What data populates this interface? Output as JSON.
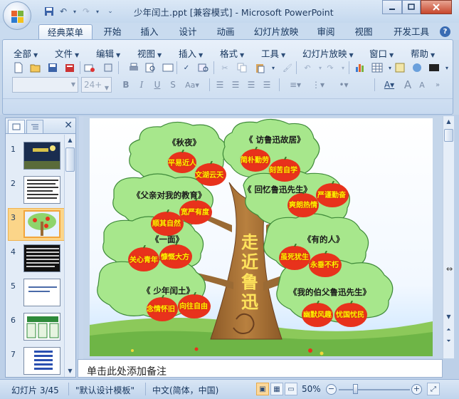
{
  "window": {
    "title": "少年闰土.ppt [兼容模式] - Microsoft PowerPoint",
    "qat": [
      "save-icon",
      "undo-icon",
      "redo-icon",
      "customize-icon"
    ]
  },
  "ribbon_tabs": [
    "经典菜单",
    "开始",
    "插入",
    "设计",
    "动画",
    "幻灯片放映",
    "审阅",
    "视图",
    "开发工具"
  ],
  "classic_menu": [
    "全部",
    "文件",
    "编辑",
    "视图",
    "插入",
    "格式",
    "工具",
    "幻灯片放映",
    "窗口",
    "帮助"
  ],
  "font": {
    "name": "",
    "size": "24+"
  },
  "slide_panel": {
    "thumbnail_numbers": [
      "1",
      "2",
      "3",
      "4",
      "5",
      "6",
      "7"
    ],
    "selected_index": 3
  },
  "slide": {
    "trunk_title": [
      "走",
      "近",
      "鲁",
      "迅"
    ],
    "branches": [
      {
        "title": "《秋夜》",
        "apples": [
          "平易近人",
          "文湖云天"
        ]
      },
      {
        "title": "《 访鲁迅故居》",
        "apples": [
          "简朴勤劳",
          "刻苦自学"
        ]
      },
      {
        "title": "《父亲对我的教育》",
        "apples": [
          "顺其自然",
          "宽严有度"
        ]
      },
      {
        "title": "《 回忆鲁迅先生》",
        "apples": [
          "爽朗热情",
          "严谨勤奋"
        ]
      },
      {
        "title": "《一面》",
        "apples": [
          "关心青年",
          "慷慨大方"
        ]
      },
      {
        "title": "《有的人》",
        "apples": [
          "虽死犹生",
          "永垂不朽"
        ]
      },
      {
        "title": "《 少年闰土》",
        "apples": [
          "念情怀旧",
          "向往自由"
        ]
      },
      {
        "title": "《我的伯父鲁迅先生》",
        "apples": [
          "幽默风趣",
          "忧国忧民"
        ]
      }
    ]
  },
  "notes": {
    "placeholder": "单击此处添加备注"
  },
  "status": {
    "slide_counter": "幻灯片 3/45",
    "template": "\"默认设计模板\"",
    "language": "中文(简体，中国)",
    "zoom": "50%"
  },
  "colors": {
    "canopy": "#a7e78c",
    "apple": "#e8321c",
    "trunk": "#b27a3c",
    "title_text": "#ffe45c"
  }
}
